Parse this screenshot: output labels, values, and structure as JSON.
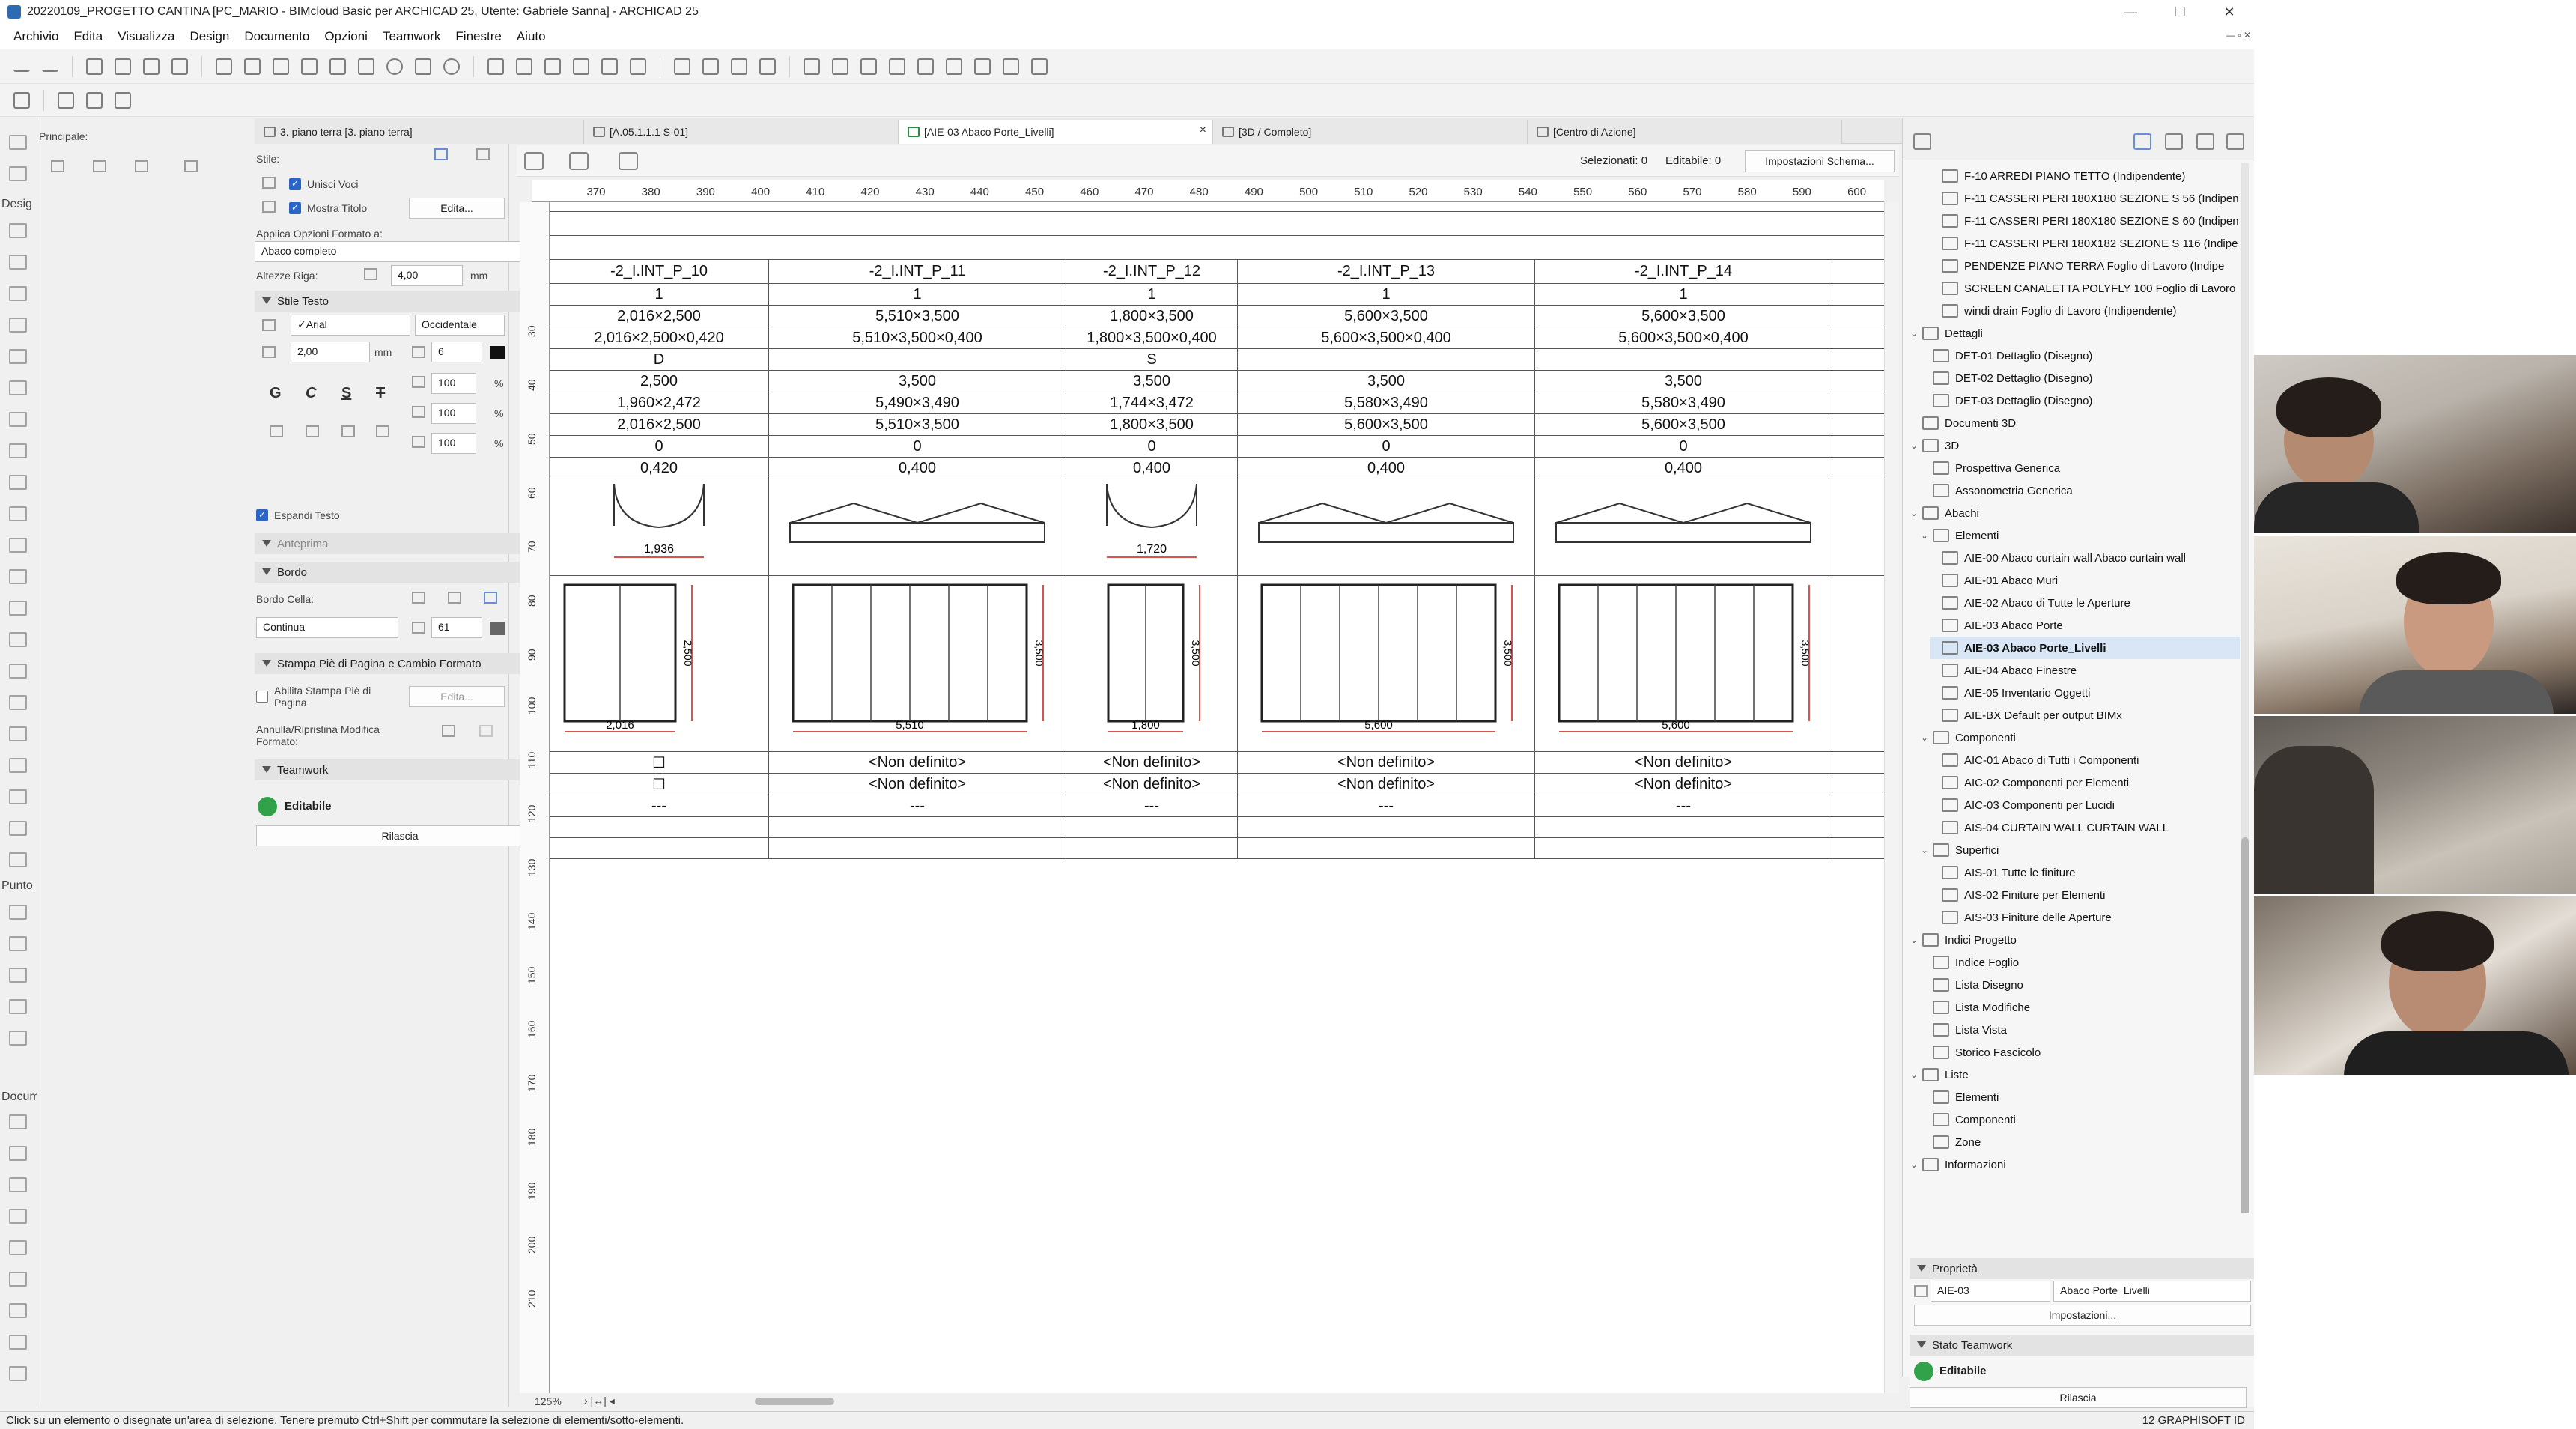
{
  "window": {
    "title": "20220109_PROGETTO CANTINA [PC_MARIO - BIMcloud Basic per ARCHICAD 25, Utente: Gabriele Sanna] - ARCHICAD 25",
    "minimize": "—",
    "maximize": "☐",
    "close": "✕"
  },
  "menu": [
    "Archivio",
    "Edita",
    "Visualizza",
    "Design",
    "Documento",
    "Opzioni",
    "Teamwork",
    "Finestre",
    "Aiuto"
  ],
  "toolbox": {
    "principale": "Principale:",
    "design": "Desig",
    "punto": "Punto",
    "docum": "Docum"
  },
  "infobox": {
    "stile_label": "Stile:",
    "unisci_voci": "Unisci Voci",
    "mostra_titolo": "Mostra Titolo",
    "edita_button": "Edita...",
    "applica_label": "Applica Opzioni Formato a:",
    "applica_value": "Abaco completo",
    "altezze_label": "Altezze Riga:",
    "altezze_value": "4,00",
    "altezze_unit": "mm",
    "stile_testo": "Stile Testo",
    "font": "✓Arial",
    "script": "Occidentale",
    "size_value": "2,00",
    "size_unit": "mm",
    "pen_value": "6",
    "pct1": "100",
    "pct2": "100",
    "pct3": "100",
    "pct_unit": "%",
    "fmt_g": "G",
    "fmt_c": "C",
    "fmt_s": "S",
    "fmt_t": "T",
    "espandi_testo": "Espandi Testo",
    "anteprima": "Anteprima",
    "bordo": "Bordo",
    "bordo_cella": "Bordo Cella:",
    "linea_value": "Continua",
    "linea_pen": "61",
    "stampa_header": "Stampa Piè di Pagina e Cambio Formato",
    "abilita_stampa": "Abilita Stampa Piè di Pagina",
    "abilita_edita": "Edita...",
    "annulla_label": "Annulla/Ripristina Modifica Formato:",
    "teamwork": "Teamwork",
    "editabile": "Editabile",
    "rilascia": "Rilascia"
  },
  "tabs": [
    {
      "label": "3. piano terra [3. piano terra]",
      "active": false
    },
    {
      "label": "[A.05.1.1.1 S-01]",
      "active": false
    },
    {
      "label": "[AIE-03 Abaco Porte_Livelli]",
      "active": true
    },
    {
      "label": "[3D / Completo]",
      "active": false
    },
    {
      "label": "[Centro di Azione]",
      "active": false
    }
  ],
  "viewheader": {
    "selected": "Selezionati: 0",
    "editable": "Editabile: 0",
    "settings_button": "Impostazioni Schema..."
  },
  "ruler_h": [
    "370",
    "380",
    "390",
    "400",
    "410",
    "420",
    "430",
    "440",
    "450",
    "460",
    "470",
    "480",
    "490",
    "500",
    "510",
    "520",
    "530",
    "540",
    "550",
    "560",
    "570",
    "580",
    "590",
    "600"
  ],
  "ruler_v": [
    "30",
    "40",
    "50",
    "60",
    "70",
    "80",
    "90",
    "100",
    "110",
    "120",
    "130",
    "140",
    "150",
    "160",
    "170",
    "180",
    "190",
    "200",
    "210"
  ],
  "schedule": {
    "columns": [
      {
        "id": "-2_I.INT_P_10",
        "rows": [
          "1",
          "2,016×2,500",
          "2,016×2,500×0,420",
          "D",
          "2,500",
          "1,960×2,472",
          "2,016×2,500",
          "0",
          "0,420"
        ],
        "plan_dim": "1,936",
        "elev_width": "2,016",
        "elev_height": "2,500",
        "extra1": "☐",
        "extra2": "☐",
        "extra3": "---"
      },
      {
        "id": "-2_I.INT_P_11",
        "rows": [
          "1",
          "5,510×3,500",
          "5,510×3,500×0,400",
          "",
          "3,500",
          "5,490×3,490",
          "5,510×3,500",
          "0",
          "0,400"
        ],
        "plan_dim": "",
        "elev_width": "5,510",
        "elev_height": "3,500",
        "extra1": "<Non definito>",
        "extra2": "<Non definito>",
        "extra3": "---"
      },
      {
        "id": "-2_I.INT_P_12",
        "rows": [
          "1",
          "1,800×3,500",
          "1,800×3,500×0,400",
          "S",
          "3,500",
          "1,744×3,472",
          "1,800×3,500",
          "0",
          "0,400"
        ],
        "plan_dim": "1,720",
        "elev_width": "1,800",
        "elev_height": "3,500",
        "extra1": "<Non definito>",
        "extra2": "<Non definito>",
        "extra3": "---"
      },
      {
        "id": "-2_I.INT_P_13",
        "rows": [
          "1",
          "5,600×3,500",
          "5,600×3,500×0,400",
          "",
          "3,500",
          "5,580×3,490",
          "5,600×3,500",
          "0",
          "0,400"
        ],
        "plan_dim": "",
        "elev_width": "5,600",
        "elev_height": "3,500",
        "extra1": "<Non definito>",
        "extra2": "<Non definito>",
        "extra3": "---"
      },
      {
        "id": "-2_I.INT_P_14",
        "rows": [
          "1",
          "5,600×3,500",
          "5,600×3,500×0,400",
          "",
          "3,500",
          "5,580×3,490",
          "5,600×3,500",
          "0",
          "0,400"
        ],
        "plan_dim": "",
        "elev_width": "5,600",
        "elev_height": "3,500",
        "extra1": "<Non definito>",
        "extra2": "<Non definito>",
        "extra3": "---"
      }
    ]
  },
  "navigator": {
    "items": [
      {
        "label": "F-10 ARREDI PIANO TETTO (Indipendente)",
        "level": 3
      },
      {
        "label": "F-11 CASSERI PERI 180X180 SEZIONE S 56 (Indipen",
        "level": 3
      },
      {
        "label": "F-11 CASSERI PERI 180X180 SEZIONE S 60 (Indipen",
        "level": 3
      },
      {
        "label": "F-11 CASSERI PERI 180X182 SEZIONE S 116 (Indipe",
        "level": 3
      },
      {
        "label": "PENDENZE PIANO TERRA  Foglio di Lavoro (Indipe",
        "level": 3
      },
      {
        "label": "SCREEN CANALETTA POLYFLY 100  Foglio di Lavoro",
        "level": 3
      },
      {
        "label": "windi drain Foglio di Lavoro (Indipendente)",
        "level": 3
      },
      {
        "label": "Dettagli",
        "level": 1,
        "open": true
      },
      {
        "label": "DET-01 Dettaglio (Disegno)",
        "level": 2
      },
      {
        "label": "DET-02 Dettaglio (Disegno)",
        "level": 2
      },
      {
        "label": "DET-03 Dettaglio (Disegno)",
        "level": 2
      },
      {
        "label": "Documenti 3D",
        "level": 1
      },
      {
        "label": "3D",
        "level": 1,
        "open": true
      },
      {
        "label": "Prospettiva Generica",
        "level": 2
      },
      {
        "label": "Assonometria Generica",
        "level": 2
      },
      {
        "label": "Abachi",
        "level": 1,
        "open": true
      },
      {
        "label": "Elementi",
        "level": 2,
        "open": true
      },
      {
        "label": "AIE-00 Abaco curtain wall Abaco curtain wall",
        "level": 3
      },
      {
        "label": "AIE-01 Abaco Muri",
        "level": 3
      },
      {
        "label": "AIE-02 Abaco di Tutte le Aperture",
        "level": 3
      },
      {
        "label": "AIE-03 Abaco Porte",
        "level": 3
      },
      {
        "label": "AIE-03 Abaco Porte_Livelli",
        "level": 3,
        "selected": true
      },
      {
        "label": "AIE-04 Abaco Finestre",
        "level": 3
      },
      {
        "label": "AIE-05 Inventario Oggetti",
        "level": 3
      },
      {
        "label": "AIE-BX Default per output BIMx",
        "level": 3
      },
      {
        "label": "Componenti",
        "level": 2,
        "open": true
      },
      {
        "label": "AIC-01 Abaco di Tutti i Componenti",
        "level": 3
      },
      {
        "label": "AIC-02 Componenti per Elementi",
        "level": 3
      },
      {
        "label": "AIC-03 Componenti per Lucidi",
        "level": 3
      },
      {
        "label": "AIS-04 CURTAIN WALL CURTAIN WALL",
        "level": 3
      },
      {
        "label": "Superfici",
        "level": 2,
        "open": true
      },
      {
        "label": "AIS-01 Tutte le finiture",
        "level": 3
      },
      {
        "label": "AIS-02 Finiture per Elementi",
        "level": 3
      },
      {
        "label": "AIS-03 Finiture delle Aperture",
        "level": 3
      },
      {
        "label": "Indici Progetto",
        "level": 1,
        "open": true
      },
      {
        "label": "Indice Foglio",
        "level": 2
      },
      {
        "label": "Lista Disegno",
        "level": 2
      },
      {
        "label": "Lista Modifiche",
        "level": 2
      },
      {
        "label": "Lista Vista",
        "level": 2
      },
      {
        "label": "Storico Fascicolo",
        "level": 2
      },
      {
        "label": "Liste",
        "level": 1,
        "open": true
      },
      {
        "label": "Elementi",
        "level": 2
      },
      {
        "label": "Componenti",
        "level": 2
      },
      {
        "label": "Zone",
        "level": 2
      },
      {
        "label": "Informazioni",
        "level": 1,
        "open": true
      }
    ]
  },
  "properties": {
    "header": "Proprietà",
    "id": "AIE-03",
    "name": "Abaco Porte_Livelli",
    "settings_button": "Impostazioni...",
    "teamwork_header": "Stato Teamwork",
    "editabile": "Editabile",
    "rilascia": "Rilascia"
  },
  "view_footer": {
    "zoom": "125%"
  },
  "status": {
    "message": "Click su un elemento o disegnate un'area di selezione. Tenere premuto Ctrl+Shift per commutare la selezione di elementi/sotto-elementi.",
    "right": "12    GRAPHISOFT ID"
  },
  "colors": {
    "accent": "#2c64c8",
    "green": "#31a14a",
    "dimension": "#d9534f",
    "selection": "#d8e6f6"
  }
}
